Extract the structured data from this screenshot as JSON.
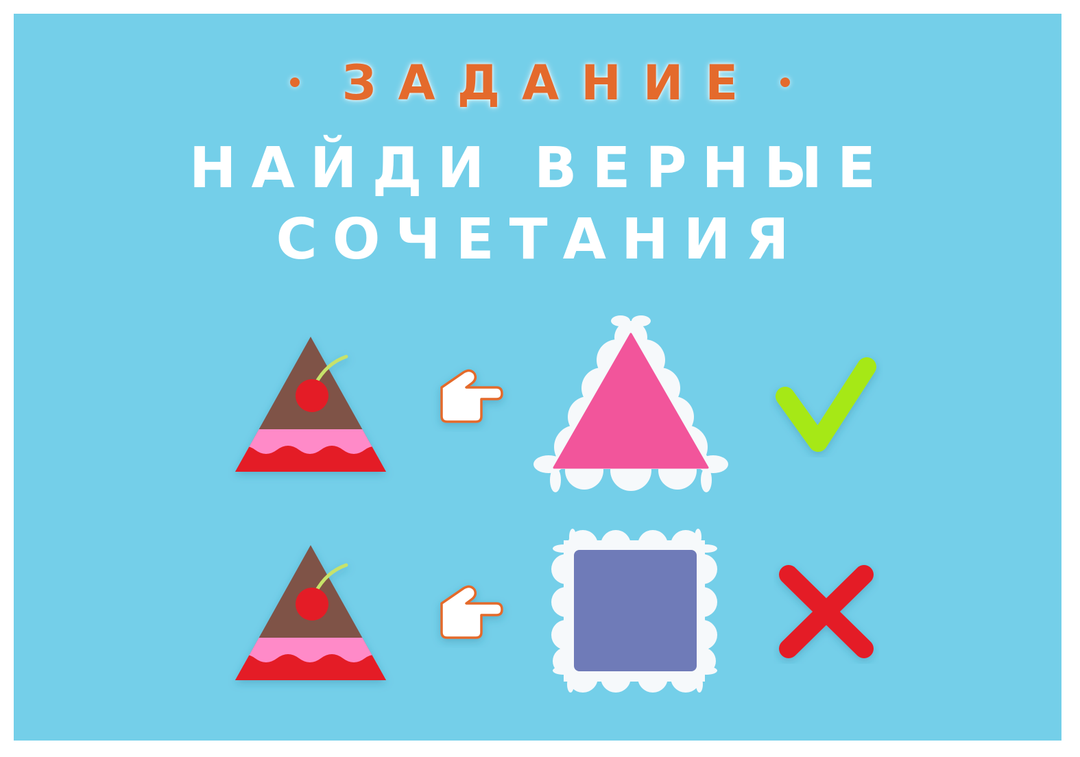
{
  "header": {
    "task_label": "ЗАДАНИЕ",
    "instruction_line1": "НАЙДИ ВЕРНЫЕ",
    "instruction_line2": "СОЧЕТАНИЯ"
  },
  "colors": {
    "background": "#74cfe9",
    "accent_orange": "#e46a2c",
    "cake_chocolate": "#7f5347",
    "cake_cream": "#ff8ac8",
    "cake_jam": "#e41d25",
    "cherry": "#e41d25",
    "stem": "#c7e26a",
    "match_shape": "#f2559b",
    "wrong_shape": "#6f7bb8",
    "doily": "#f6f9fb",
    "check": "#a6e812",
    "cross": "#e41d25"
  },
  "examples": [
    {
      "object": "cake-slice-triangle",
      "shape": "triangle",
      "result": "correct",
      "result_icon": "checkmark-icon"
    },
    {
      "object": "cake-slice-triangle",
      "shape": "square",
      "result": "incorrect",
      "result_icon": "cross-icon"
    }
  ]
}
